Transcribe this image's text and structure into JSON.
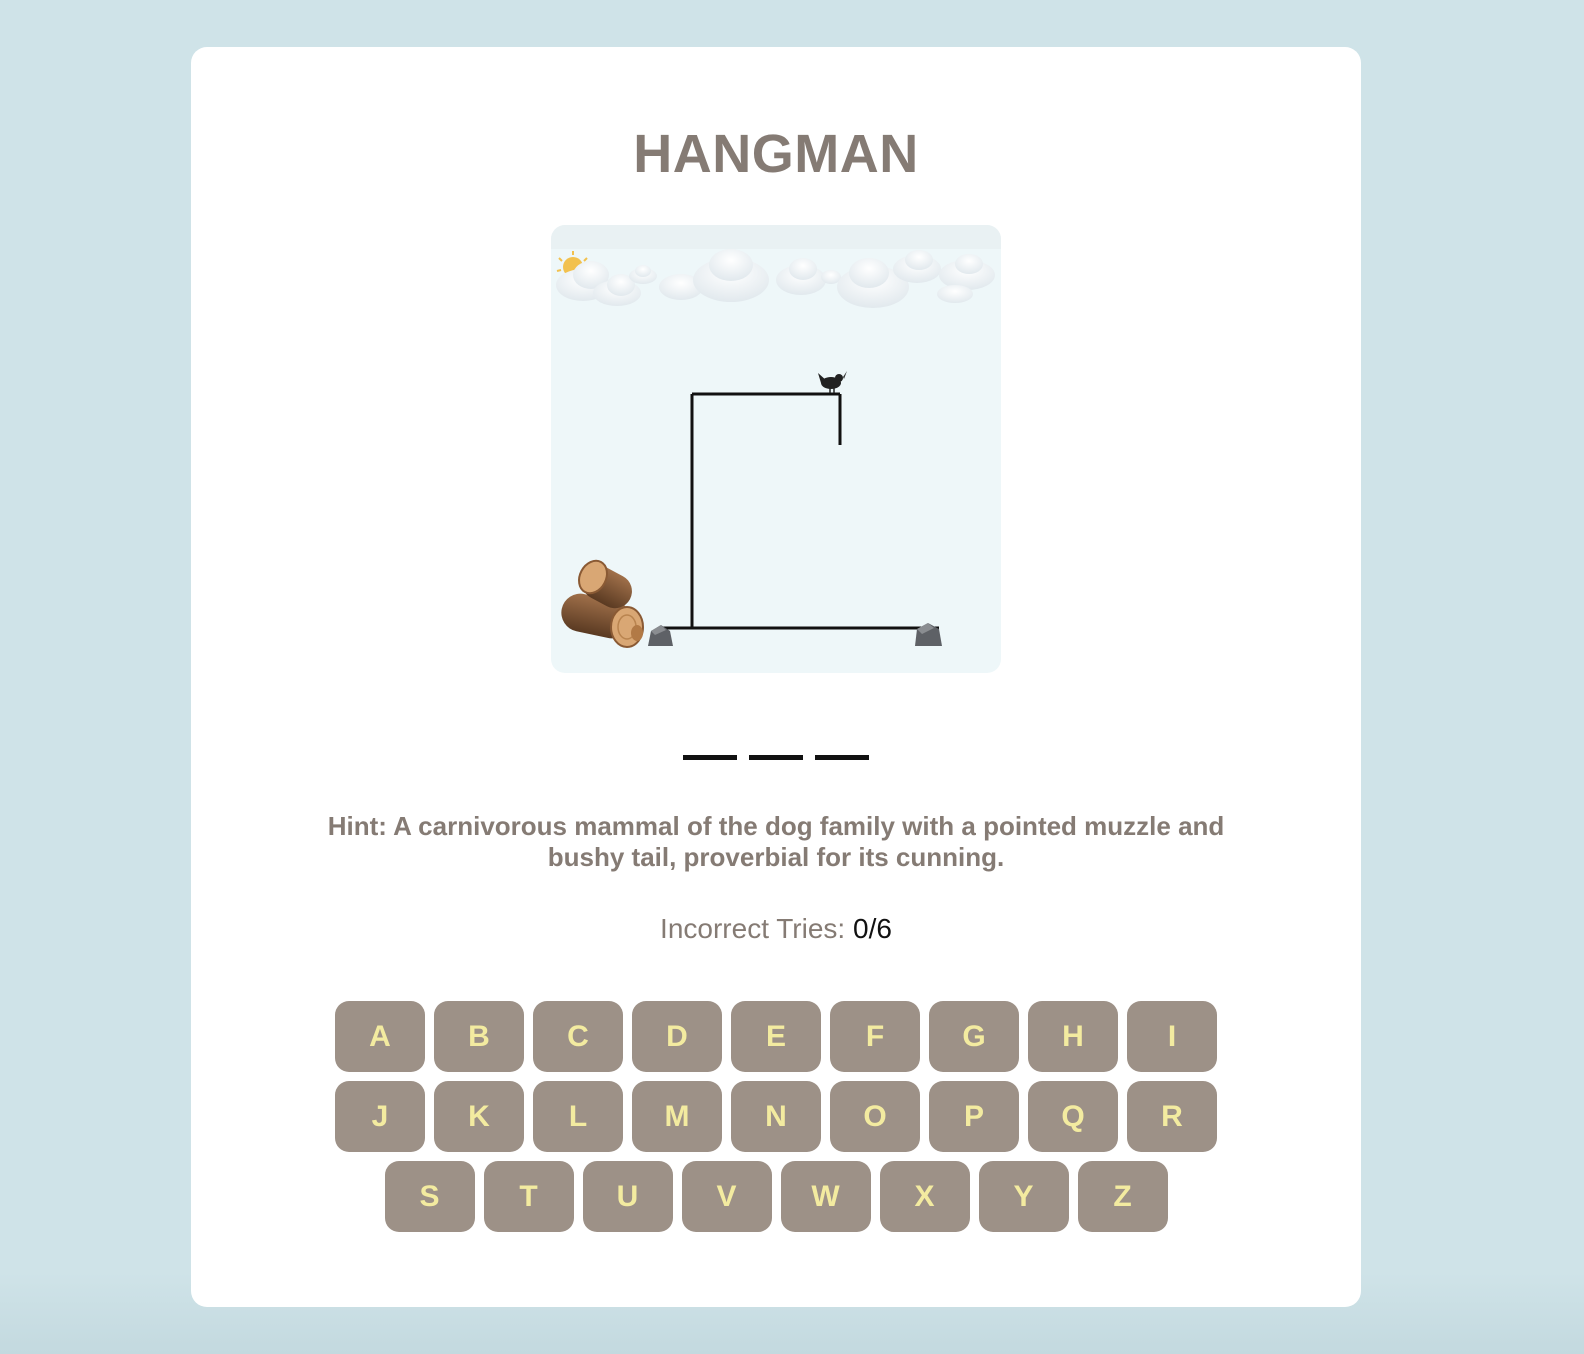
{
  "game": {
    "title": "HANGMAN",
    "word_blanks": [
      "",
      "",
      ""
    ],
    "hint": "Hint: A carnivorous mammal of the dog family with a pointed muzzle and bushy tail, proverbial for its cunning.",
    "tries_label": "Incorrect Tries:",
    "tries_value": "0/6",
    "incorrect_tries": 0,
    "max_tries": 6
  },
  "scene": {
    "icons": [
      "sun-behind-cloud-icon",
      "cloud-icon",
      "bird-icon",
      "log-icon",
      "rock-icon"
    ]
  },
  "keyboard": {
    "keys": [
      "A",
      "B",
      "C",
      "D",
      "E",
      "F",
      "G",
      "H",
      "I",
      "J",
      "K",
      "L",
      "M",
      "N",
      "O",
      "P",
      "Q",
      "R",
      "S",
      "T",
      "U",
      "V",
      "W",
      "X",
      "Y",
      "Z"
    ]
  },
  "colors": {
    "page_background": "#cfe3e8",
    "card_background": "#ffffff",
    "title_text": "#857b74",
    "key_background": "#9d9187",
    "key_text": "#f3eba0",
    "scene_background": "#eef7f9"
  }
}
